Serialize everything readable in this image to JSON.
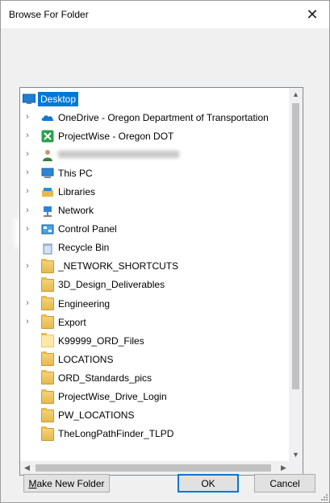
{
  "window": {
    "title": "Browse For Folder",
    "close_glyph": "✕"
  },
  "prompt": "",
  "tree": {
    "items": [
      {
        "label": "Desktop",
        "icon": "desktop-icon",
        "expander": "",
        "selected": true
      },
      {
        "label": "OneDrive - Oregon Department of Transportation",
        "icon": "onedrive-cloud-icon",
        "expander": "›"
      },
      {
        "label": "ProjectWise - Oregon DOT",
        "icon": "projectwise-icon",
        "expander": "›"
      },
      {
        "label": "",
        "icon": "user-icon",
        "expander": "›",
        "blurred": true
      },
      {
        "label": "This PC",
        "icon": "computer-icon",
        "expander": "›"
      },
      {
        "label": "Libraries",
        "icon": "libraries-icon",
        "expander": "›"
      },
      {
        "label": "Network",
        "icon": "network-icon",
        "expander": "›"
      },
      {
        "label": "Control Panel",
        "icon": "control-panel-icon",
        "expander": "›"
      },
      {
        "label": "Recycle Bin",
        "icon": "recycle-bin-icon",
        "expander": ""
      },
      {
        "label": "_NETWORK_SHORTCUTS",
        "icon": "folder-icon",
        "expander": "›"
      },
      {
        "label": "3D_Design_Deliverables",
        "icon": "folder-icon",
        "expander": ""
      },
      {
        "label": "Engineering",
        "icon": "folder-icon",
        "expander": "›"
      },
      {
        "label": "Export",
        "icon": "folder-icon",
        "expander": "›"
      },
      {
        "label": "K99999_ORD_Files",
        "icon": "folder-icon",
        "expander": "",
        "highlighted": true
      },
      {
        "label": "LOCATIONS",
        "icon": "folder-icon",
        "expander": ""
      },
      {
        "label": "ORD_Standards_pics",
        "icon": "folder-icon",
        "expander": ""
      },
      {
        "label": "ProjectWise_Drive_Login",
        "icon": "folder-icon",
        "expander": ""
      },
      {
        "label": "PW_LOCATIONS",
        "icon": "folder-icon",
        "expander": ""
      },
      {
        "label": "TheLongPathFinder_TLPD",
        "icon": "folder-icon",
        "expander": ""
      }
    ]
  },
  "scrollbars": {
    "up": "▲",
    "down": "▼",
    "left": "◀",
    "right": "▶"
  },
  "buttons": {
    "make_new_folder_prefix": "",
    "make_new_folder_mnemonic": "M",
    "make_new_folder_rest": "ake New Folder",
    "ok": "OK",
    "cancel": "Cancel"
  },
  "colors": {
    "selection": "#0078d7",
    "folder": "#e7b94c",
    "accent_border": "#0078d7"
  }
}
